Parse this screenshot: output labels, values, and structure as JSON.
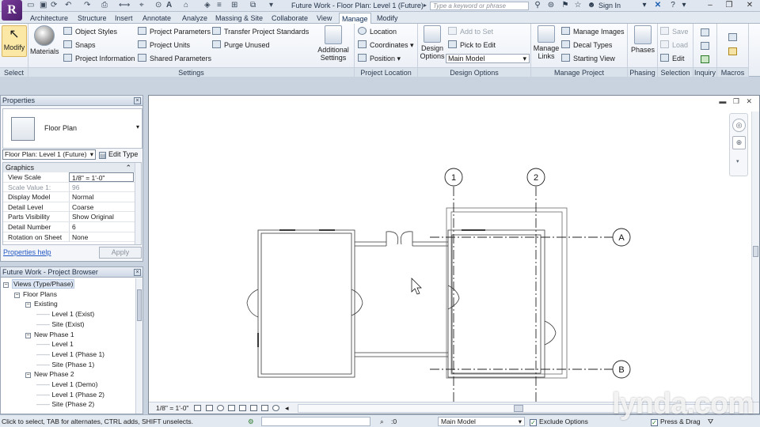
{
  "window": {
    "title": "Future Work - Floor Plan: Level 1 (Future)",
    "search_placeholder": "Type a keyword or phrase",
    "sign_in": "Sign In",
    "app_logo": "R"
  },
  "tabs": [
    "Architecture",
    "Structure",
    "Insert",
    "Annotate",
    "Analyze",
    "Massing & Site",
    "Collaborate",
    "View",
    "Manage",
    "Modify"
  ],
  "active_tab": "Manage",
  "ribbon": {
    "select": {
      "modify": "Modify",
      "panel": "Select"
    },
    "settings": {
      "materials": "Materials",
      "object_styles": "Object Styles",
      "snaps": "Snaps",
      "project_information": "Project Information",
      "project_parameters": "Project Parameters",
      "project_units": "Project Units",
      "shared_parameters": "Shared Parameters",
      "transfer_standards": "Transfer Project Standards",
      "purge_unused": "Purge Unused",
      "additional_settings_1": "Additional",
      "additional_settings_2": "Settings",
      "panel": "Settings"
    },
    "project_location": {
      "location": "Location",
      "coordinates": "Coordinates",
      "position": "Position",
      "panel": "Project Location"
    },
    "design_options": {
      "design_options_1": "Design",
      "design_options_2": "Options",
      "add_to_set": "Add to Set",
      "pick_to_edit": "Pick to Edit",
      "current_option": "Main Model",
      "panel": "Design Options"
    },
    "manage_project": {
      "manage_links_1": "Manage",
      "manage_links_2": "Links",
      "manage_images": "Manage Images",
      "decal_types": "Decal Types",
      "starting_view": "Starting View",
      "panel": "Manage Project"
    },
    "phasing": {
      "phases": "Phases",
      "panel": "Phasing"
    },
    "selection": {
      "save": "Save",
      "load": "Load",
      "edit": "Edit",
      "panel": "Selection"
    },
    "inquiry": {
      "panel": "Inquiry"
    },
    "macros": {
      "panel": "Macros"
    }
  },
  "properties": {
    "title": "Properties",
    "type_name": "Floor Plan",
    "instance": "Floor Plan: Level 1 (Future)",
    "edit_type": "Edit Type",
    "group": "Graphics",
    "rows": [
      {
        "key": "View Scale",
        "value": "1/8\" = 1'-0\""
      },
      {
        "key": "Scale Value    1:",
        "value": "96"
      },
      {
        "key": "Display Model",
        "value": "Normal"
      },
      {
        "key": "Detail Level",
        "value": "Coarse"
      },
      {
        "key": "Parts Visibility",
        "value": "Show Original"
      },
      {
        "key": "Detail Number",
        "value": "6"
      },
      {
        "key": "Rotation on Sheet",
        "value": "None"
      }
    ],
    "help": "Properties help",
    "apply": "Apply"
  },
  "browser": {
    "title": "Future Work - Project Browser",
    "items": [
      {
        "label": "Views (Type/Phase)",
        "level": 0,
        "expander": "-"
      },
      {
        "label": "Floor Plans",
        "level": 1,
        "expander": "-"
      },
      {
        "label": "Existing",
        "level": 2,
        "expander": "-"
      },
      {
        "label": "Level 1 (Exist)",
        "level": 3,
        "expander": ""
      },
      {
        "label": "Site (Exist)",
        "level": 3,
        "expander": ""
      },
      {
        "label": "New Phase 1",
        "level": 2,
        "expander": "-"
      },
      {
        "label": "Level 1",
        "level": 3,
        "expander": ""
      },
      {
        "label": "Level 1 (Phase 1)",
        "level": 3,
        "expander": ""
      },
      {
        "label": "Site (Phase 1)",
        "level": 3,
        "expander": ""
      },
      {
        "label": "New Phase 2",
        "level": 2,
        "expander": "-"
      },
      {
        "label": "Level 1 (Demo)",
        "level": 3,
        "expander": ""
      },
      {
        "label": "Level 1 (Phase 2)",
        "level": 3,
        "expander": ""
      },
      {
        "label": "Site (Phase 2)",
        "level": 3,
        "expander": ""
      }
    ]
  },
  "drawing": {
    "grids": {
      "g1": "1",
      "g2": "2",
      "ga": "A",
      "gb": "B"
    },
    "view_scale": "1/8\" = 1'-0\""
  },
  "status": {
    "text": "Click to select, TAB for alternates, CTRL adds, SHIFT unselects.",
    "workset": ":0",
    "design_option": "Main Model",
    "exclude_options": "Exclude Options",
    "press_drag": "Press & Drag"
  },
  "watermark": "lynda.com"
}
